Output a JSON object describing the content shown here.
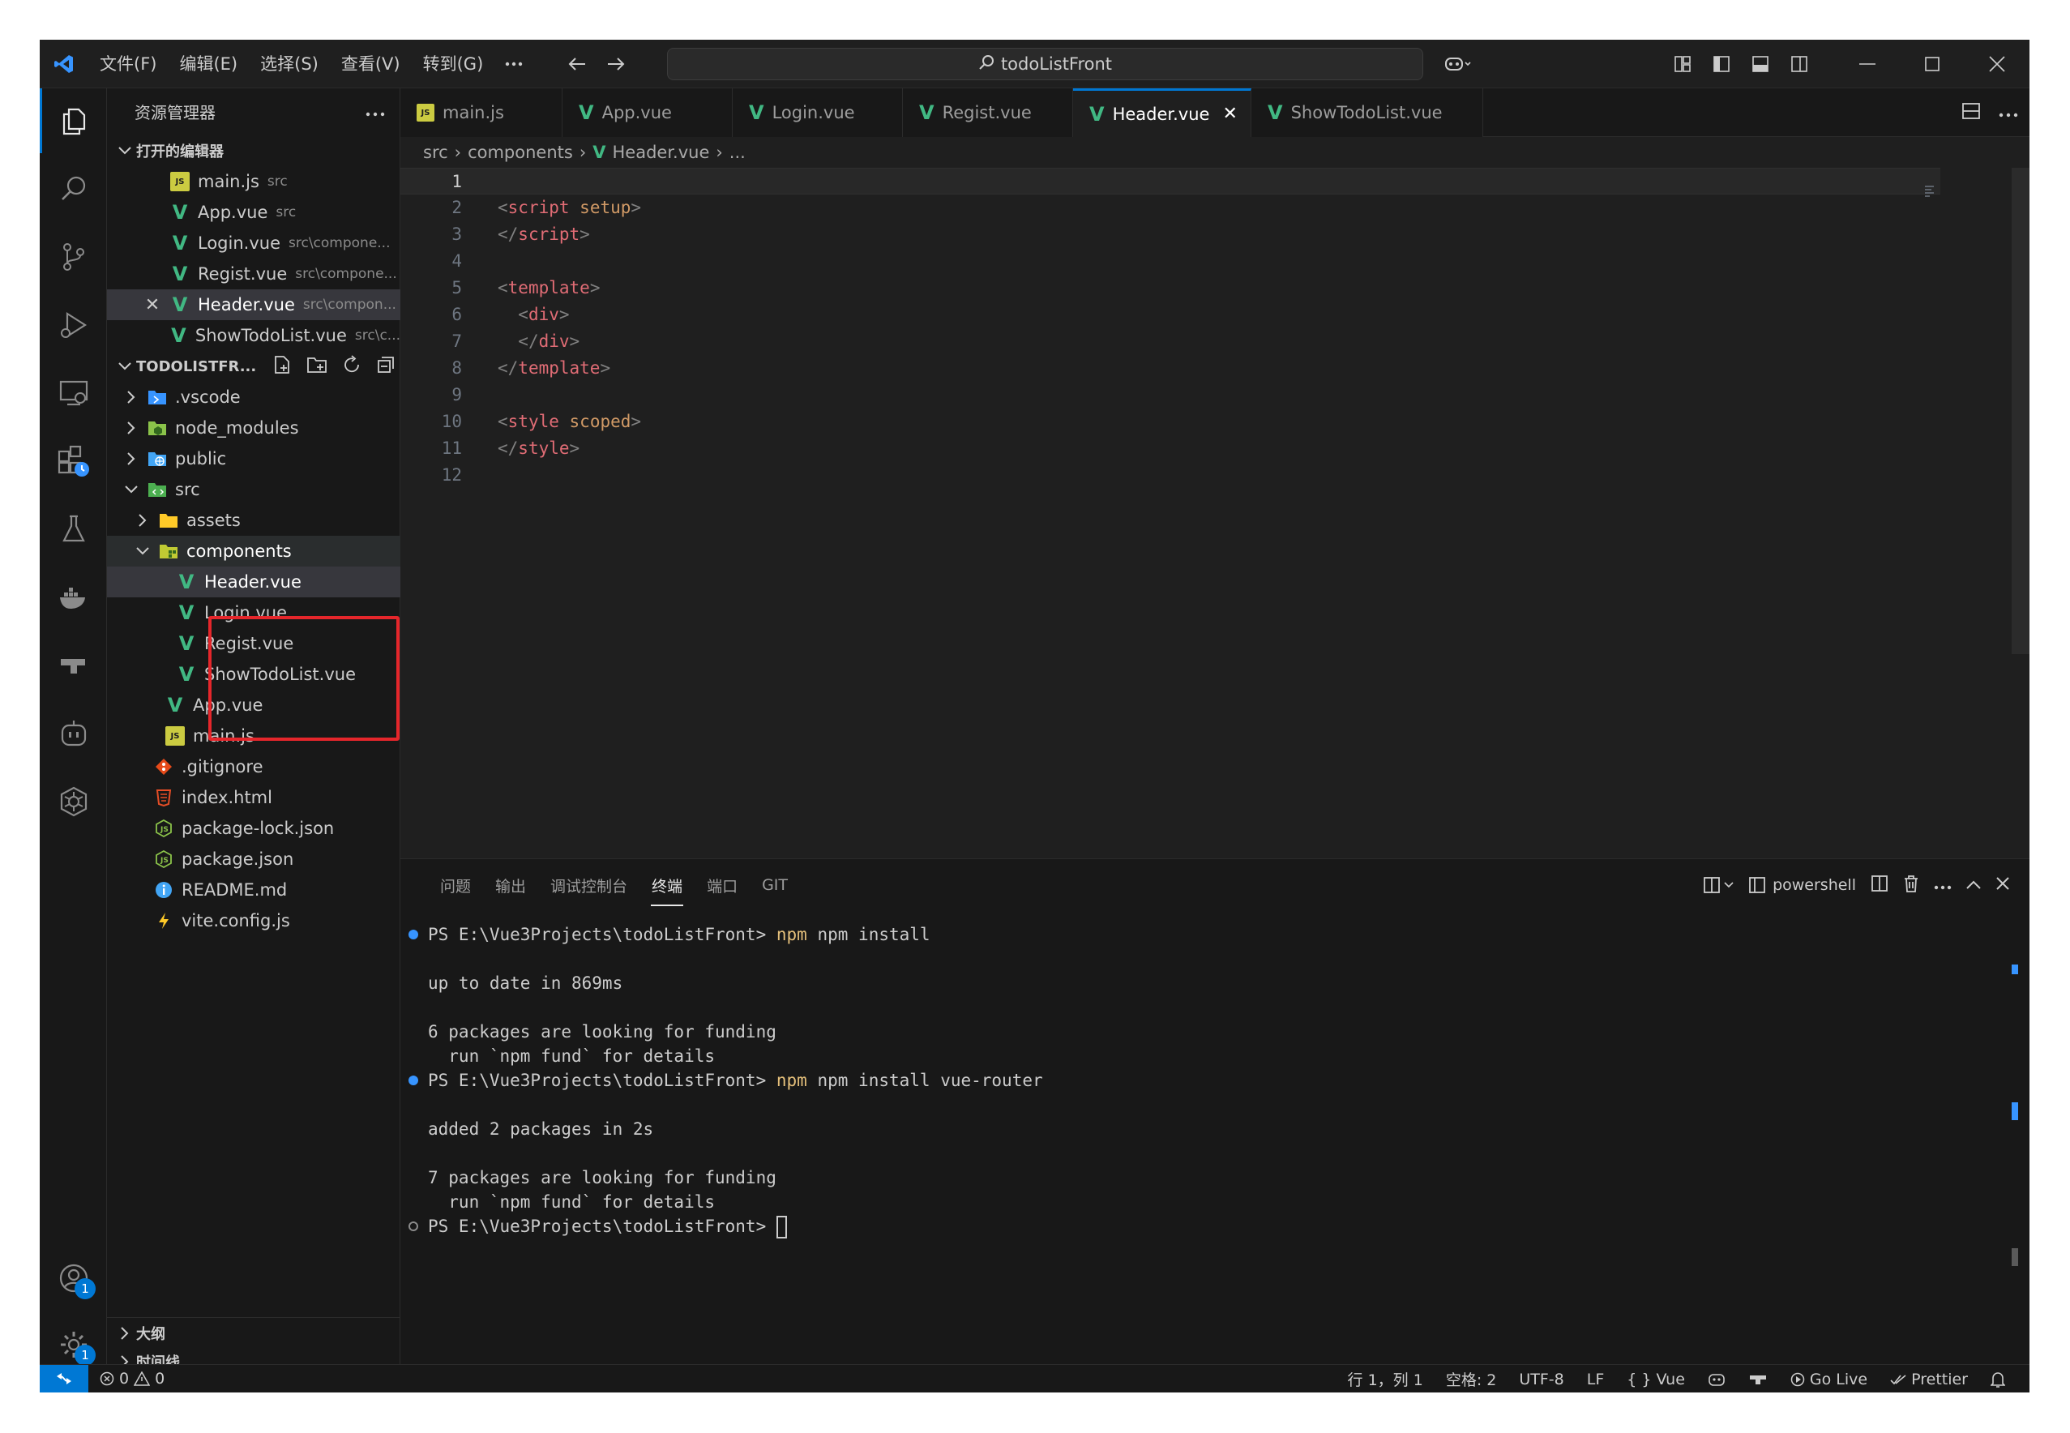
{
  "menu": [
    "文件(F)",
    "编辑(E)",
    "选择(S)",
    "查看(V)",
    "转到(G)"
  ],
  "search": {
    "text": "todoListFront"
  },
  "colors": {
    "accent": "#0078d4",
    "vue": "#41b883",
    "highlight_box": "#e5262b",
    "js": "#cbcb41"
  },
  "sidebar": {
    "title": "资源管理器",
    "open_editors": {
      "label": "打开的编辑器",
      "items": [
        {
          "name": "main.js",
          "desc": "src"
        },
        {
          "name": "App.vue",
          "desc": "src"
        },
        {
          "name": "Login.vue",
          "desc": "src\\compone..."
        },
        {
          "name": "Regist.vue",
          "desc": "src\\compone..."
        },
        {
          "name": "Header.vue",
          "desc": "src\\compon..."
        },
        {
          "name": "ShowTodoList.vue",
          "desc": "src\\c..."
        }
      ]
    },
    "project": {
      "label": "TODOLISTFR...",
      "items": [
        {
          "name": ".vscode"
        },
        {
          "name": "node_modules"
        },
        {
          "name": "public"
        },
        {
          "name": "src"
        },
        {
          "name": "assets"
        },
        {
          "name": "components"
        },
        {
          "name": "Header.vue"
        },
        {
          "name": "Login.vue"
        },
        {
          "name": "Regist.vue"
        },
        {
          "name": "ShowTodoList.vue"
        },
        {
          "name": "App.vue"
        },
        {
          "name": "main.js"
        },
        {
          "name": ".gitignore"
        },
        {
          "name": "index.html"
        },
        {
          "name": "package-lock.json"
        },
        {
          "name": "package.json"
        },
        {
          "name": "README.md"
        },
        {
          "name": "vite.config.js"
        }
      ]
    },
    "outline": "大纲",
    "timeline": "时间线"
  },
  "tabs": [
    {
      "label": "main.js"
    },
    {
      "label": "App.vue"
    },
    {
      "label": "Login.vue"
    },
    {
      "label": "Regist.vue"
    },
    {
      "label": "Header.vue"
    },
    {
      "label": "ShowTodoList.vue"
    }
  ],
  "breadcrumb": {
    "part1": "src",
    "part2": "components",
    "part3": "Header.vue",
    "part4": "..."
  },
  "code": {
    "line_numbers": [
      "1",
      "2",
      "3",
      "4",
      "5",
      "6",
      "7",
      "8",
      "9",
      "10",
      "11",
      "12"
    ]
  },
  "panel": {
    "tabs": [
      "问题",
      "输出",
      "调试控制台",
      "终端",
      "端口",
      "GIT"
    ],
    "shell": "powershell",
    "terminal": {
      "prompt": "PS E:\\Vue3Projects\\todoListFront>",
      "cmd1": "npm install",
      "out1": "up to date in 869ms",
      "out2": "6 packages are looking for funding",
      "out3": "  run `npm fund` for details",
      "cmd2": "npm install vue-router",
      "out4": "added 2 packages in 2s",
      "out5": "7 packages are looking for funding",
      "out6": "  run `npm fund` for details"
    }
  },
  "status": {
    "errors": "0",
    "warnings": "0",
    "position": "行 1，列 1",
    "spaces": "空格: 2",
    "encoding": "UTF-8",
    "eol": "LF",
    "language": "Vue",
    "golive": "Go Live",
    "prettier": "Prettier"
  },
  "badges": {
    "accounts": "1",
    "settings": "1"
  }
}
